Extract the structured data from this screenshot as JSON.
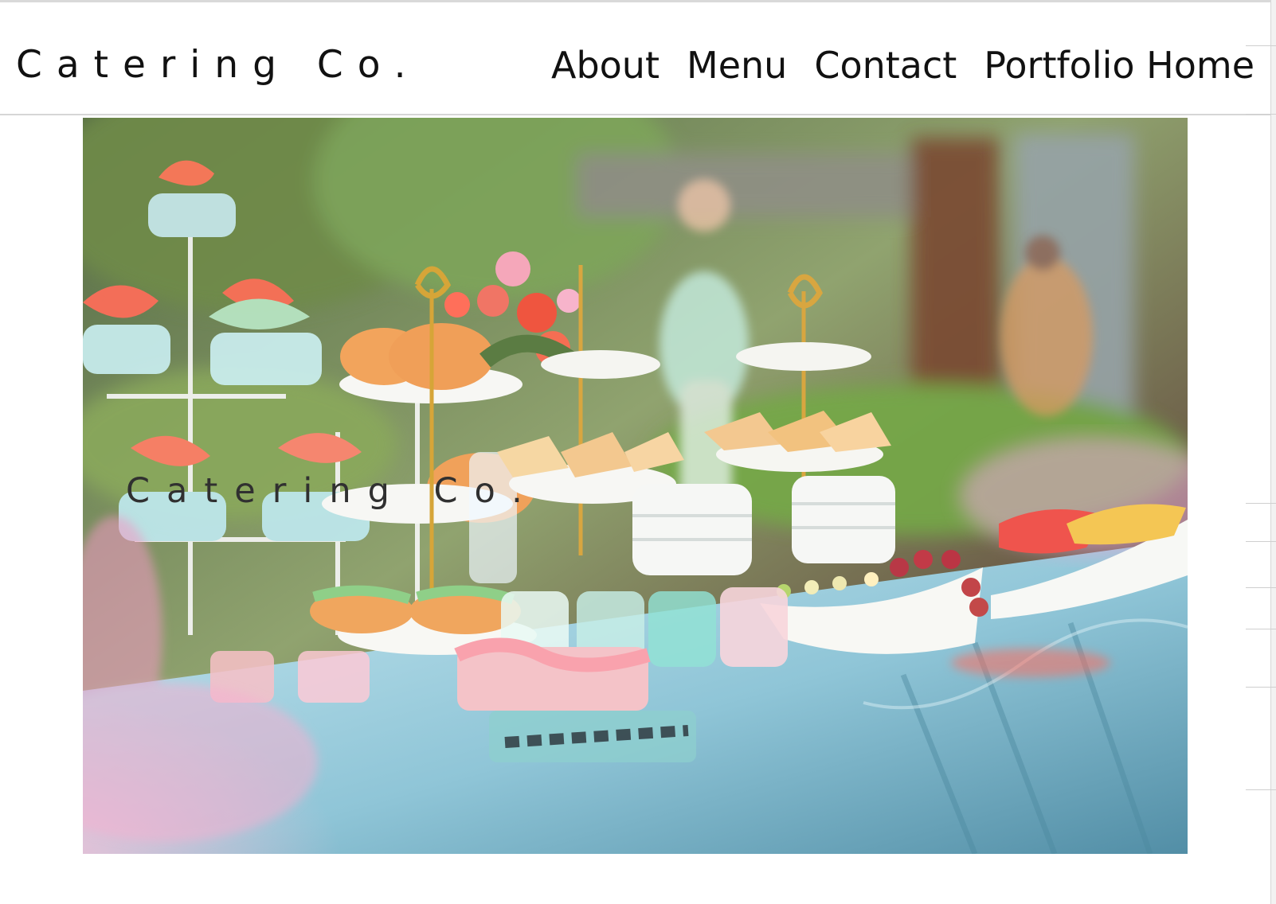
{
  "header": {
    "brand": "Catering Co.",
    "nav": {
      "about": "About",
      "menu": "Menu",
      "contact": "Contact",
      "portfolio_home": "Portfolio Home"
    }
  },
  "hero": {
    "overlay_brand": "Catering Co."
  },
  "colors": {
    "text": "#111111",
    "border": "#d6d6d6",
    "tablecloth": "#8fc5d7",
    "pastel_pink": "#f3b8c8",
    "coral": "#ff6b4f"
  },
  "icons": {
    "photo": "catering-table-photo"
  }
}
